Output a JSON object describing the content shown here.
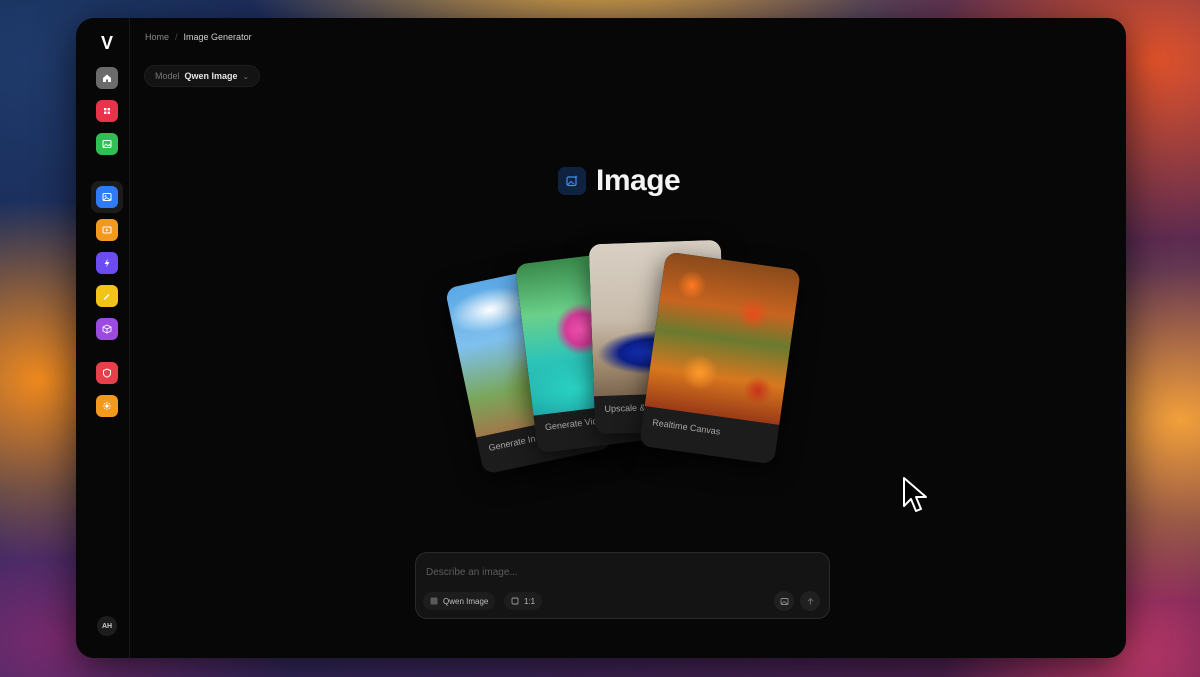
{
  "app": {
    "logo_letter": "V",
    "accent": "#2f7bf6"
  },
  "breadcrumb": {
    "home": "Home",
    "separator": "/",
    "current": "Image Generator"
  },
  "model_selector": {
    "label": "Model",
    "value": "Qwen Image"
  },
  "sidebar": {
    "items": [
      {
        "icon": "home-icon",
        "color": "#6b6b6b"
      },
      {
        "icon": "grid-icon",
        "color": "#e8334a"
      },
      {
        "icon": "gallery-icon",
        "color": "#2fbf55"
      },
      {
        "icon": "image-icon",
        "color": "#2f7bf6",
        "active": true
      },
      {
        "icon": "video-icon",
        "color": "#f39a1e"
      },
      {
        "icon": "lightning-icon",
        "color": "#6a4cf0"
      },
      {
        "icon": "edit-icon",
        "color": "#f2c418"
      },
      {
        "icon": "cube-icon",
        "color": "#9b4be0"
      },
      {
        "icon": "shield-icon",
        "color": "#e8404a"
      },
      {
        "icon": "sparkle-icon",
        "color": "#f39a1e"
      }
    ],
    "avatar_initials": "AH"
  },
  "hero": {
    "title": "Image"
  },
  "cards": [
    {
      "caption": "Generate In..."
    },
    {
      "caption": "Generate Vid..."
    },
    {
      "caption": "Upscale &..."
    },
    {
      "caption": "Realtime Canvas"
    }
  ],
  "composer": {
    "placeholder": "Describe an image...",
    "model_chip": "Qwen Image",
    "ratio_chip": "1:1"
  }
}
